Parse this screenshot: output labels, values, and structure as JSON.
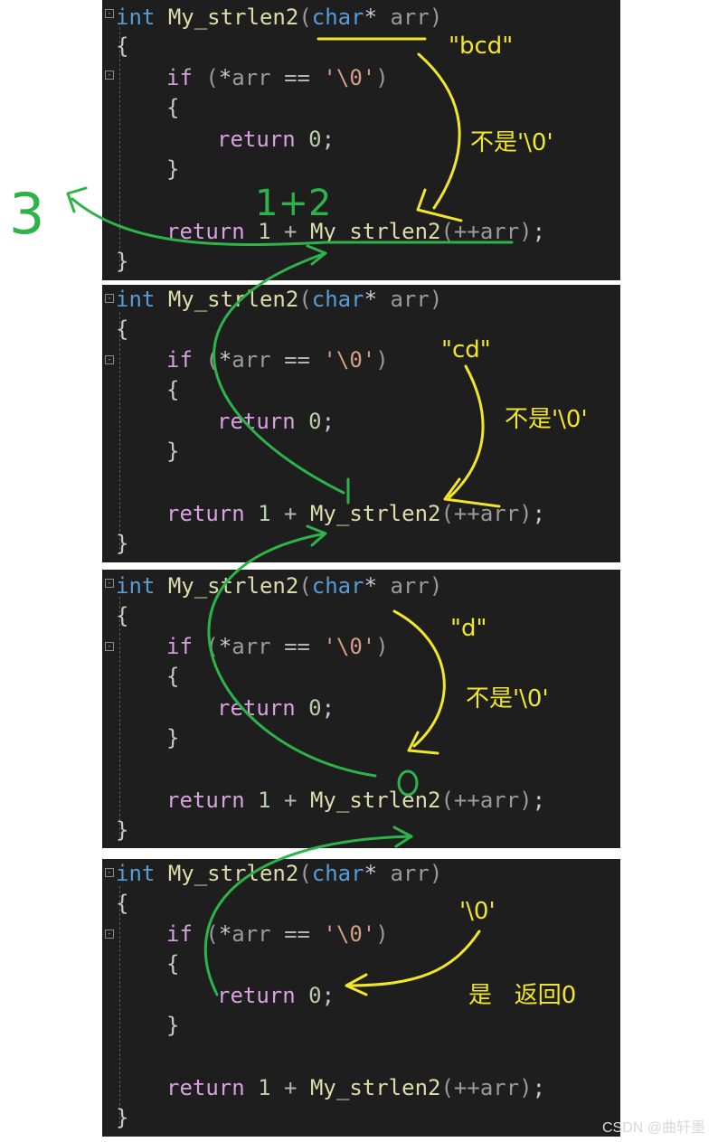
{
  "code": {
    "sig": {
      "int": "int",
      "fn": "My_strlen2",
      "open": "(",
      "char": "char",
      "star": "*",
      "arg": " arr",
      "close": ")"
    },
    "brace_open": "{",
    "brace_close": "}",
    "if_kw": "if",
    "if_rest_a": " (",
    "if_star": "*",
    "if_arr": "arr",
    "if_eq": " == ",
    "if_char": "'\\0'",
    "if_close": ")",
    "ret_kw": "return",
    "ret_zero": "0",
    "semi": ";",
    "ret_one": "1",
    "plus": " + ",
    "call_fn": "My_strlen2",
    "call_open": "(",
    "call_arg": "++arr",
    "call_close": ")"
  },
  "annotations": {
    "p1_str": "\"bcd\"",
    "p2_str": "\"cd\"",
    "p3_str": "\"d\"",
    "p4_str": "'\\0'",
    "not_null": "不是'\\0'",
    "is_null": "是   返回0",
    "green_3": "3",
    "green_expr": "1+2",
    "green_1": "1",
    "green_0": "0"
  },
  "watermark": "CSDN @曲轩墨",
  "colors": {
    "bg": "#1e1e1e",
    "keyword": "#569cd6",
    "control": "#d8a0df",
    "function": "#dcdcaa",
    "string": "#d69d85",
    "yellow_ink": "#f2e62a",
    "green_ink": "#2db34a"
  }
}
